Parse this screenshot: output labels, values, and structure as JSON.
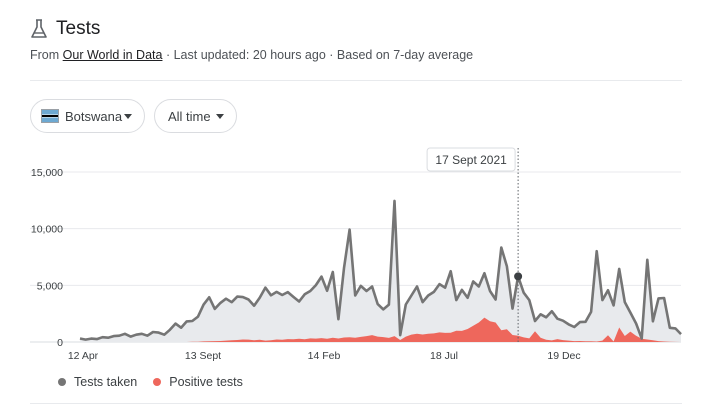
{
  "header": {
    "title": "Tests",
    "from_prefix": "From",
    "source_link": "Our World in Data",
    "last_updated": "· Last updated: 20 hours ago",
    "average_note": "· Based on 7-day average"
  },
  "filters": {
    "country": "Botswana",
    "range": "All time"
  },
  "tooltip": {
    "date": "17 Sept 2021"
  },
  "legend": {
    "tests": "Tests taken",
    "positive": "Positive tests"
  },
  "colors": {
    "tests_line": "#757575",
    "tests_fill": "#e8eaed",
    "positive": "#ee675c",
    "grid": "#e8eaed"
  },
  "chart_data": {
    "type": "area",
    "y_ticks": [
      "15,000",
      "10,000",
      "5,000",
      "0"
    ],
    "y_tick_values": [
      15000,
      10000,
      5000,
      0
    ],
    "x_ticks": [
      "12 Apr",
      "13 Sept",
      "14 Feb",
      "18 Jul",
      "19 Dec"
    ],
    "ylim": [
      0,
      15000
    ],
    "grid": true,
    "hover_index": 78,
    "series": [
      {
        "name": "Tests taken",
        "values": [
          310,
          210,
          300,
          260,
          420,
          380,
          520,
          560,
          720,
          480,
          640,
          720,
          560,
          880,
          830,
          640,
          1080,
          1620,
          1260,
          1820,
          1850,
          2240,
          3300,
          3940,
          2920,
          3450,
          3820,
          3510,
          4010,
          3960,
          3750,
          3200,
          3900,
          4800,
          4120,
          4420,
          4150,
          4400,
          3980,
          3570,
          4210,
          4500,
          5020,
          5770,
          4520,
          6180,
          2010,
          6520,
          9920,
          4100,
          4950,
          4500,
          4900,
          3340,
          2880,
          3300,
          12450,
          600,
          3310,
          4100,
          4900,
          3520,
          4100,
          4420,
          5110,
          4790,
          6250,
          3700,
          4600,
          3900,
          5350,
          4900,
          6070,
          4500,
          3750,
          8340,
          6670,
          2950,
          5790,
          4350,
          3700,
          1850,
          2440,
          2180,
          2720,
          2060,
          1880,
          1550,
          1320,
          1760,
          1780,
          2660,
          8010,
          3700,
          4560,
          3230,
          6450,
          3520,
          2590,
          1630,
          300,
          7250,
          1830,
          3850,
          3880,
          1250,
          1200,
          700
        ],
        "color": "#757575"
      },
      {
        "name": "Positive tests",
        "values": [
          0,
          0,
          0,
          0,
          0,
          0,
          0,
          0,
          0,
          0,
          0,
          0,
          0,
          0,
          0,
          0,
          0,
          0,
          0,
          0,
          20,
          30,
          50,
          60,
          80,
          90,
          120,
          160,
          180,
          220,
          210,
          160,
          190,
          120,
          150,
          220,
          200,
          260,
          240,
          280,
          250,
          320,
          300,
          340,
          280,
          380,
          310,
          400,
          420,
          380,
          450,
          520,
          610,
          480,
          430,
          360,
          520,
          180,
          480,
          650,
          720,
          660,
          720,
          760,
          850,
          800,
          820,
          1000,
          980,
          1150,
          1440,
          1720,
          2150,
          1830,
          1720,
          1040,
          1120,
          620,
          560,
          410,
          320,
          950,
          380,
          200,
          140,
          260,
          170,
          120,
          80,
          90,
          70,
          60,
          40,
          120,
          600,
          40,
          1280,
          530,
          920,
          550,
          280,
          220,
          160,
          80,
          40,
          20,
          10,
          0
        ],
        "color": "#ee675c"
      }
    ]
  }
}
